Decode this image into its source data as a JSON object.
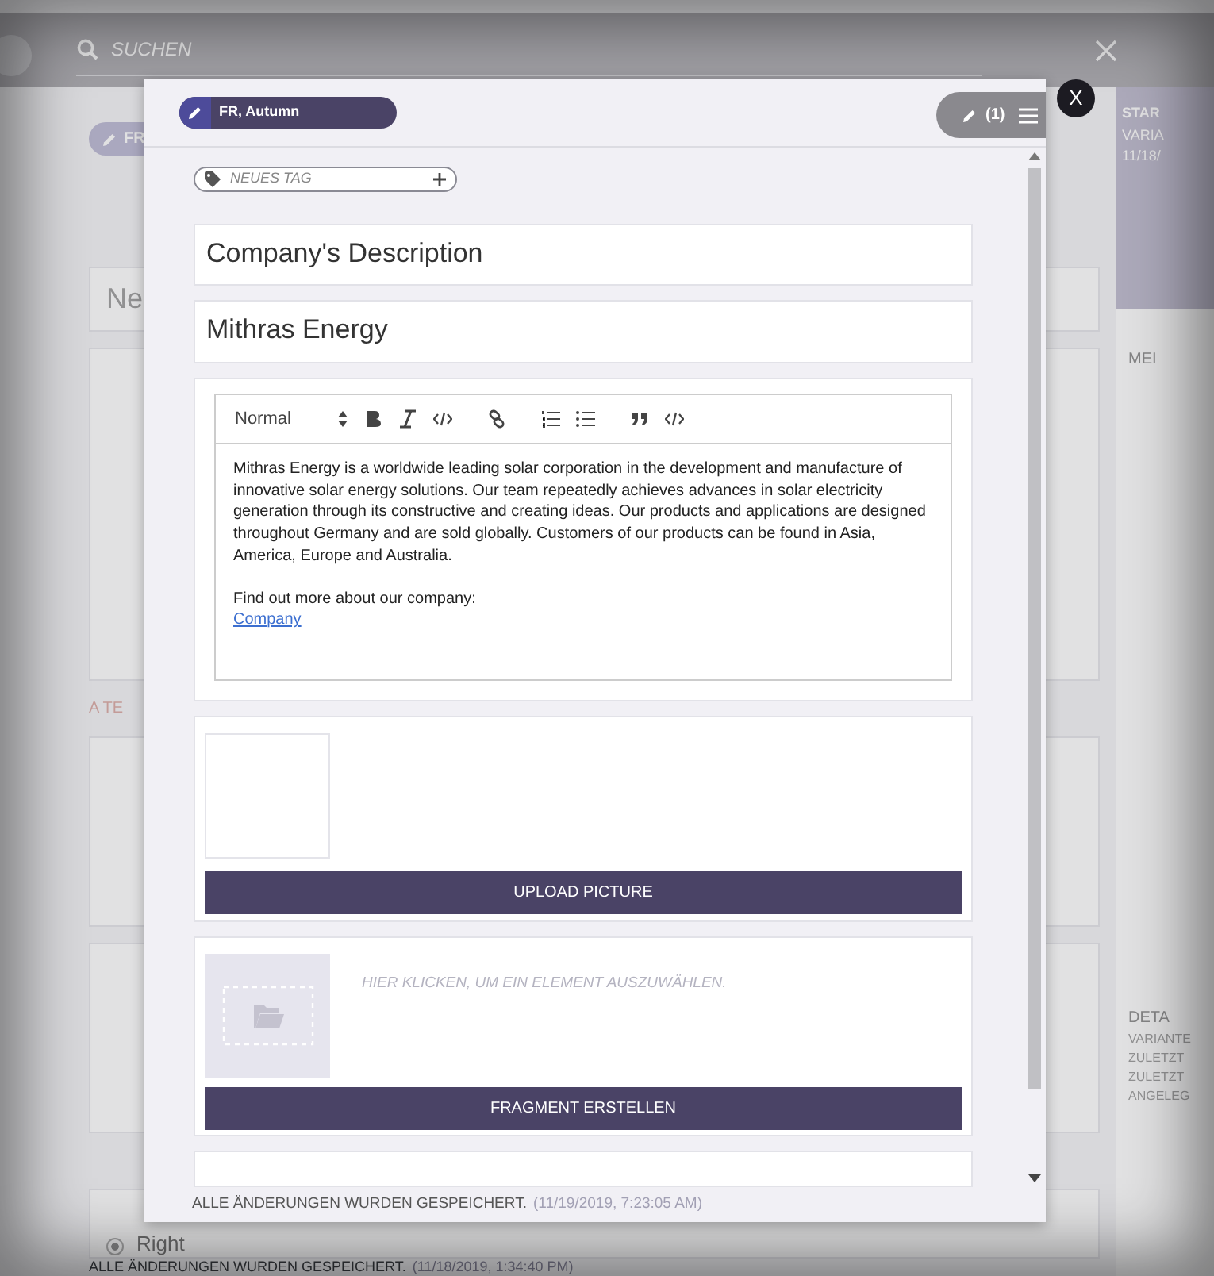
{
  "background": {
    "search_placeholder": "SUCHEN",
    "chip_label": "FR",
    "title_fragment": "Ne",
    "section_fragment": "A TE",
    "side_title": "STAR",
    "side_lines": [
      "VARIA",
      "11/18/"
    ],
    "comments_label": "MEI",
    "details_label": "DETA",
    "details_lines": [
      "VARIANTE",
      "ZULETZT",
      "ZULETZT",
      "ANGELEG"
    ],
    "radio": {
      "label": "Right",
      "selected": true
    },
    "status": "ALLE ÄNDERUNGEN WURDEN GESPEICHERT.",
    "status_time": "(11/18/2019, 1:34:40 PM)"
  },
  "dialog": {
    "variant_chip": "FR, Autumn",
    "edits_count": "(1)",
    "close": "X",
    "tag_placeholder": "NEUES TAG",
    "fields": [
      {
        "kind": "text",
        "value": "Company's Description"
      },
      {
        "kind": "text",
        "value": "Mithras Energy"
      },
      {
        "kind": "richtext",
        "format": "Normal",
        "paragraphs": [
          "Mithras Energy is a worldwide leading solar corporation in the development and manufacture of innovative solar energy solutions. Our team repeatedly achieves advances in solar electricity generation through its constructive and creating ideas. Our products and applications are designed throughout Germany and are sold globally. Customers of our products can be found in Asia, America, Europe and Australia.",
          "Find out more about our company:"
        ],
        "link": "Company"
      },
      {
        "kind": "image",
        "button": "UPLOAD PICTURE"
      },
      {
        "kind": "fragment",
        "hint": "HIER KLICKEN, UM EIN ELEMENT AUSZUWÄHLEN.",
        "button": "FRAGMENT ERSTELLEN"
      },
      {
        "kind": "blank"
      }
    ],
    "status": "ALLE ÄNDERUNGEN WURDEN GESPEICHERT.",
    "status_time": "(11/19/2019, 7:23:05 AM)"
  }
}
